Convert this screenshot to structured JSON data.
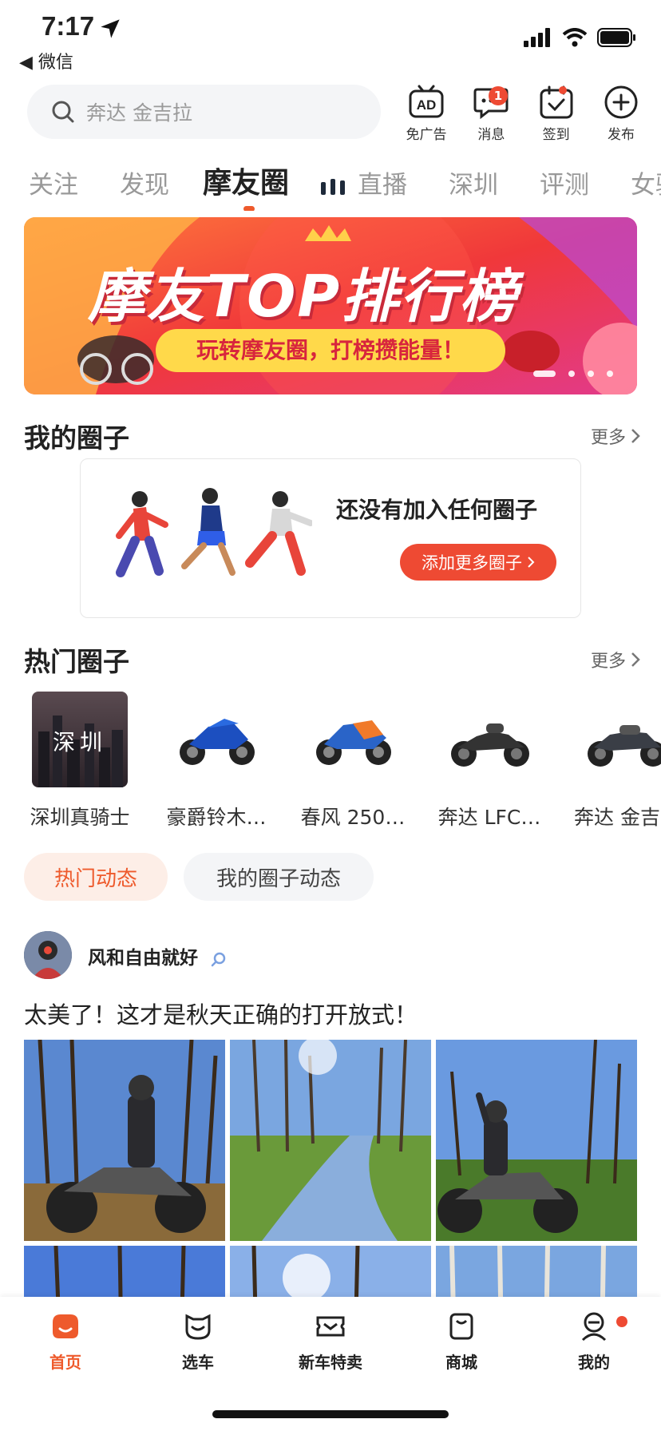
{
  "status_bar": {
    "time": "7:17",
    "back_app": "微信"
  },
  "search": {
    "placeholder": "奔达 金吉拉"
  },
  "top_icons": [
    {
      "label": "免广告",
      "icon": "ad-icon"
    },
    {
      "label": "消息",
      "icon": "message-icon",
      "badge": "1"
    },
    {
      "label": "签到",
      "icon": "checkin-icon"
    },
    {
      "label": "发布",
      "icon": "plus-circle-icon"
    }
  ],
  "tabs": [
    "关注",
    "发现",
    "摩友圈",
    "直播",
    "深圳",
    "评测",
    "女骑"
  ],
  "active_tab": "摩友圈",
  "banner": {
    "title": "摩友TOP排行榜",
    "subtitle": "玩转摩友圈，打榜攒能量！"
  },
  "my_circles": {
    "title": "我的圈子",
    "more": "更多",
    "empty_text": "还没有加入任何圈子",
    "add_button": "添加更多圈子"
  },
  "hot_circles": {
    "title": "热门圈子",
    "more": "更多",
    "items": [
      {
        "name": "深圳真骑士",
        "thumb_text": "深圳"
      },
      {
        "name": "豪爵铃木…"
      },
      {
        "name": "春风 250…"
      },
      {
        "name": "奔达 LFC…"
      },
      {
        "name": "奔达 金吉"
      }
    ]
  },
  "feed_filters": {
    "hot": "热门动态",
    "mine": "我的圈子动态"
  },
  "post": {
    "user": "风和自由就好",
    "text": "太美了！这才是秋天正确的打开放式！"
  },
  "tab_bar": [
    {
      "label": "首页",
      "icon": "home-icon"
    },
    {
      "label": "选车",
      "icon": "car-select-icon"
    },
    {
      "label": "新车特卖",
      "icon": "ticket-icon"
    },
    {
      "label": "商城",
      "icon": "shop-icon"
    },
    {
      "label": "我的",
      "icon": "profile-icon"
    }
  ],
  "colors": {
    "accent": "#ee5a2c",
    "badge": "#ee4a33"
  }
}
